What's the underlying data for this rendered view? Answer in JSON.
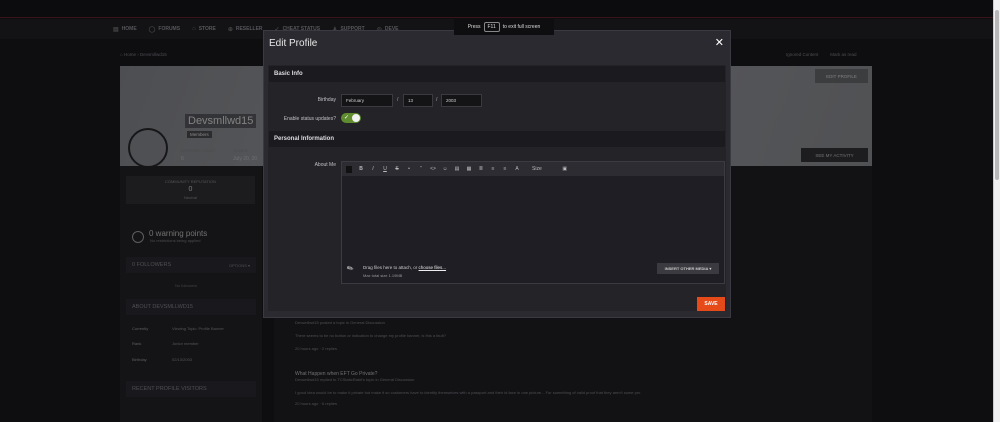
{
  "nav": {
    "items": [
      {
        "icon": "home-icon",
        "label": "HOME"
      },
      {
        "icon": "forums-icon",
        "label": "FORUMS"
      },
      {
        "icon": "store-icon",
        "label": "STORE"
      },
      {
        "icon": "reseller-icon",
        "label": "RESELLER"
      },
      {
        "icon": "status-icon",
        "label": "CHEAT STATUS"
      },
      {
        "icon": "support-icon",
        "label": "SUPPORT"
      },
      {
        "icon": "dev-icon",
        "label": "DEVE"
      }
    ]
  },
  "fullscreen": {
    "prefix": "Press",
    "key": "F11",
    "suffix": "to exit full screen"
  },
  "breadcrumb": {
    "home": "Home",
    "user": "Devsmllwd15"
  },
  "header_links": {
    "ignore": "Ignored Content",
    "unread": "Mark as read"
  },
  "profile": {
    "username": "Devsmllwd15",
    "role": "Members",
    "edit_button": "EDIT PROFILE",
    "see_activity": "SEE MY ACTIVITY",
    "stats": [
      {
        "label": "CONTENT COUNT",
        "value": "6"
      },
      {
        "label": "JOINED",
        "value": "July 20, 20"
      }
    ],
    "reputation": {
      "label": "COMMUNITY REPUTATION",
      "value": "0",
      "status": "Neutral"
    },
    "reputation_note": "",
    "warnings": {
      "title": "0 warning points",
      "sub": "No restrictions being applied"
    },
    "followers": {
      "title": "0 FOLLOWERS",
      "options": "OPTIONS ▾",
      "empty": "No followers"
    },
    "about": {
      "title": "ABOUT DEVSMLLWD15",
      "rows": [
        {
          "label": "Currently",
          "value": "Viewing Topic: Profile Banner"
        },
        {
          "label": "Rank",
          "value": "Junior member"
        },
        {
          "label": "Birthday",
          "value": "02/13/2003"
        }
      ]
    },
    "visitors": {
      "title": "RECENT PROFILE VISITORS"
    }
  },
  "posts": [
    {
      "title": "",
      "meta": "Devsmllwd15 posted a topic in General Discussion",
      "body": "There seems to be no button or indication to change my profile banner, is this a fault?",
      "footer": "20 hours ago   ·   2 replies"
    },
    {
      "title": "What Happen when EFT Go Private?",
      "meta": "Devsmllwd15 replied to TCStaticRabit's topic in General Discussion",
      "body": "I good idea would be to make it private but make it so customers have to identify themselves with a passport and their id face in one picture... For something of valid proof that they aren't some pro",
      "footer": "20 hours ago   ·   6 replies"
    }
  ],
  "modal": {
    "title": "Edit Profile",
    "close": "✕",
    "basic_info": "Basic Info",
    "birthday_label": "Birthday",
    "birthday": {
      "month": "February",
      "day": "13",
      "year": "2003"
    },
    "status_label": "Enable status updates?",
    "status_enabled": true,
    "personal_info": "Personal Information",
    "about_label": "About Me",
    "toolbar": [
      "B",
      "I",
      "U",
      "S",
      "•",
      "“",
      "<>",
      "☺",
      "▤",
      "▦",
      "≣",
      "≡",
      "≡",
      "A",
      "Size",
      "▣"
    ],
    "attach_text": "Drag files here to attach, or",
    "attach_link": "choose files...",
    "attach_sub": "Max total size 1.19MB",
    "insert_media": "INSERT OTHER MEDIA ▾",
    "save": "SAVE"
  },
  "colors": {
    "accent": "#e64a19",
    "toggle": "#5f8c2f",
    "background": "#1b1b1f"
  }
}
